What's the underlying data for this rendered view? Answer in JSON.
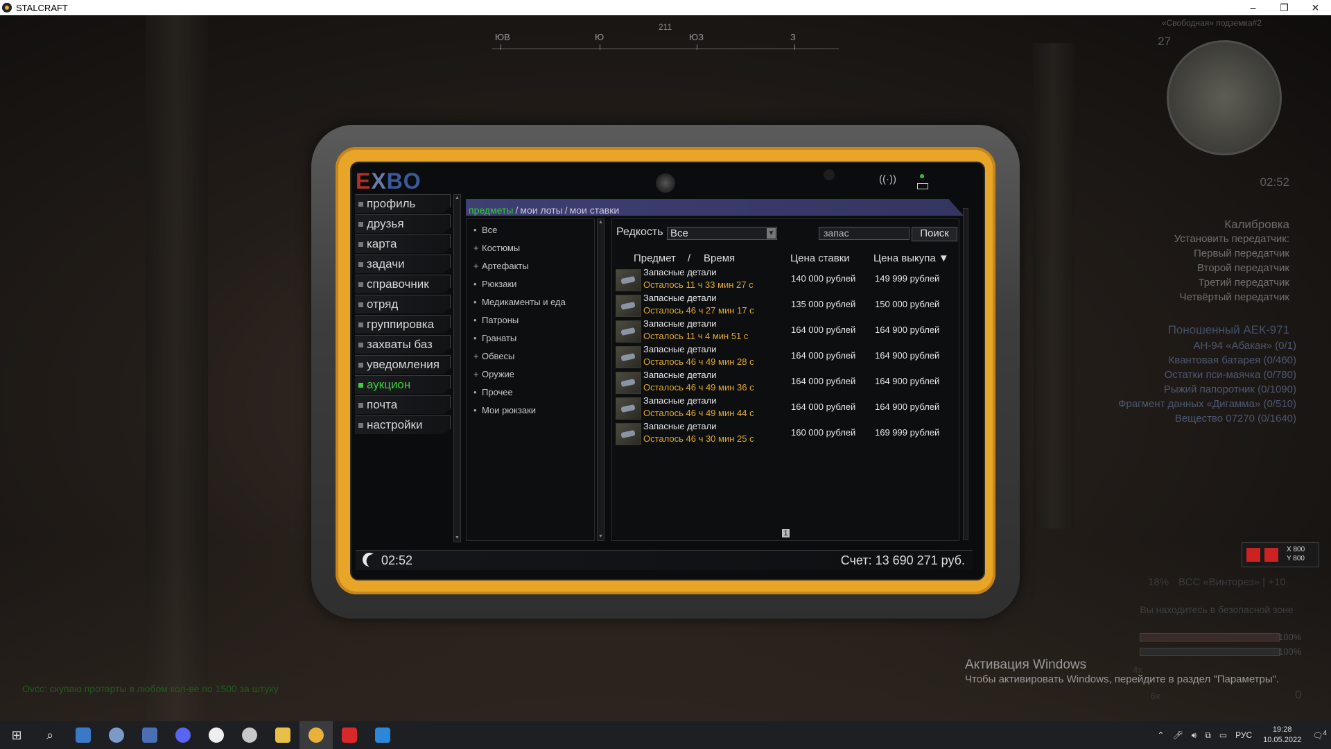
{
  "window": {
    "title": "STALCRAFT",
    "min": "–",
    "max": "❐",
    "close": "✕"
  },
  "compass": {
    "labels": [
      "ЮВ",
      "Ю",
      "ЮЗ",
      "З"
    ],
    "degree": "211"
  },
  "hud": {
    "server": "«Свободная» подземка#2",
    "level": "27",
    "time": "02:52",
    "calib_title": "Калибровка",
    "calib_items": [
      "Установить передатчик:",
      "Первый передатчик",
      "Второй передатчик",
      "Третий передатчик",
      "Четвёртый передатчик"
    ],
    "weapon_title": "Поношенный АЕК-971",
    "quest_items": [
      "АН-94 «Абакан» (0/1)",
      "Квантовая батарея (0/460)",
      "Остатки пси-маячка (0/780)",
      "Рыжий папоротник (0/1090)",
      "Фрагмент данных «Дигамма» (0/510)",
      "Вещество 07270 (0/1640)"
    ],
    "weapon_status": "ВСС «Винторез» | +10",
    "weapon_pct": "18%",
    "safe_zone": "Вы находитесь в безопасной зоне",
    "hp": "100%",
    "stamina": "100%",
    "scope": "4x",
    "scope2": "6x",
    "ammo_x": "X 800",
    "ammo_y": "Y 800",
    "kills": "0"
  },
  "tablet": {
    "brand": {
      "e": "E",
      "x": "X",
      "bo": "BO"
    },
    "sidebar": [
      "профиль",
      "друзья",
      "карта",
      "задачи",
      "справочник",
      "отряд",
      "группировка",
      "захваты баз",
      "уведомления",
      "аукцион",
      "почта",
      "настройки"
    ],
    "active_index": 9,
    "tabs": {
      "items": "предметы",
      "sep1": "/",
      "lots": "мои лоты",
      "sep2": "/",
      "bids": "мои ставки"
    },
    "categories": [
      {
        "mark": "•",
        "label": "Все"
      },
      {
        "mark": "+",
        "label": "Костюмы"
      },
      {
        "mark": "+",
        "label": "Артефакты"
      },
      {
        "mark": "•",
        "label": "Рюкзаки"
      },
      {
        "mark": "•",
        "label": "Медикаменты и еда"
      },
      {
        "mark": "•",
        "label": "Патроны"
      },
      {
        "mark": "•",
        "label": "Гранаты"
      },
      {
        "mark": "+",
        "label": "Обвесы"
      },
      {
        "mark": "+",
        "label": "Оружие"
      },
      {
        "mark": "•",
        "label": "Прочее"
      },
      {
        "mark": "•",
        "label": "Мои рюкзаки"
      }
    ],
    "filter": {
      "rarity_label": "Редкость",
      "rarity_value": "Все",
      "search_value": "запас",
      "search_button": "Поиск"
    },
    "columns": {
      "item": "Предмет",
      "sep": "/",
      "time": "Время",
      "bid": "Цена ставки",
      "buyout": "Цена выкупа ▼"
    },
    "rows": [
      {
        "name": "Запасные детали",
        "time": "Осталось 11 ч 33 мин 27 с",
        "bid": "140 000 рублей",
        "buyout": "149 999 рублей"
      },
      {
        "name": "Запасные детали",
        "time": "Осталось 46 ч 27 мин 17 с",
        "bid": "135 000 рублей",
        "buyout": "150 000 рублей"
      },
      {
        "name": "Запасные детали",
        "time": "Осталось 11 ч 4 мин 51 с",
        "bid": "164 000 рублей",
        "buyout": "164 900 рублей"
      },
      {
        "name": "Запасные детали",
        "time": "Осталось 46 ч 49 мин 28 с",
        "bid": "164 000 рублей",
        "buyout": "164 900 рублей"
      },
      {
        "name": "Запасные детали",
        "time": "Осталось 46 ч 49 мин 36 с",
        "bid": "164 000 рублей",
        "buyout": "164 900 рублей"
      },
      {
        "name": "Запасные детали",
        "time": "Осталось 46 ч 49 мин 44 с",
        "bid": "164 000 рублей",
        "buyout": "164 900 рублей"
      },
      {
        "name": "Запасные детали",
        "time": "Осталось 46 ч 30 мин 25 с",
        "bid": "160 000 рублей",
        "buyout": "169 999 рублей"
      }
    ],
    "page": "1",
    "clock": "02:52",
    "account": "Счет: 13 690 271 руб."
  },
  "chat": "Ovcc: скупаю протарты в любом кол-ве по 1500 за штуку",
  "windows_activation": {
    "title": "Активация Windows",
    "text": "Чтобы активировать Windows, перейдите в раздел \"Параметры\"."
  },
  "taskbar": {
    "lang": "РУС",
    "time": "19:28",
    "date": "10.05.2022",
    "notif": "4"
  },
  "colors": {
    "accent_green": "#3ccf3c",
    "time_orange": "#e1a92a",
    "frame_yellow": "#e9a528"
  }
}
